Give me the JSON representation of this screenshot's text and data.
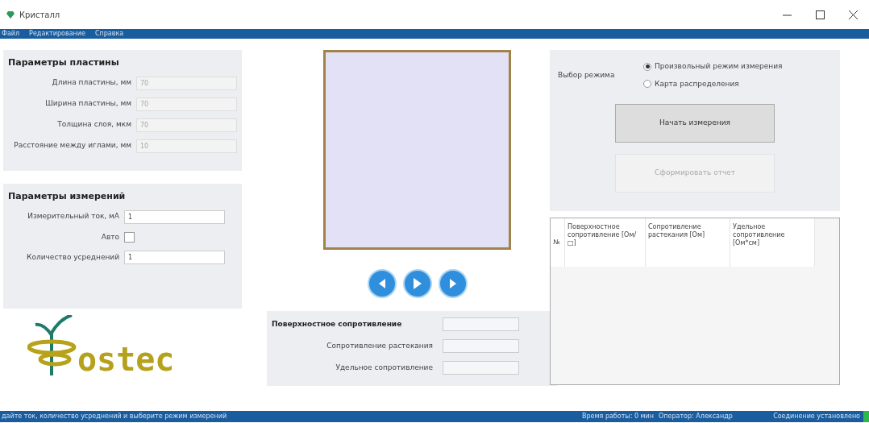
{
  "window": {
    "title": "Кристалл"
  },
  "menu": [
    "Файл",
    "Редактирование",
    "Справка"
  ],
  "plate_params": {
    "title": "Параметры пластины",
    "fields": [
      {
        "label": "Длина пластины, мм",
        "value": "70",
        "disabled": true
      },
      {
        "label": "Ширина пластины, мм",
        "value": "70",
        "disabled": true
      },
      {
        "label": "Толщина слоя, мкм",
        "value": "70",
        "disabled": true
      },
      {
        "label": "Расстояние между иглами, мм",
        "value": "10",
        "disabled": true
      }
    ]
  },
  "measure_params": {
    "title": "Параметры измерений",
    "rows": [
      {
        "kind": "input",
        "label": "Измерительный ток, мА",
        "value": "1"
      },
      {
        "kind": "checkbox",
        "label": "Авто",
        "checked": false
      },
      {
        "kind": "input",
        "label": "Количество усреднений",
        "value": "1"
      }
    ]
  },
  "logo": {
    "text": "ostec"
  },
  "nav_buttons": [
    {
      "kind": "back"
    },
    {
      "kind": "play"
    },
    {
      "kind": "forward"
    }
  ],
  "results": [
    {
      "label": "Поверхностное сопротивление",
      "bold": true
    },
    {
      "label": "Сопротивление растекания",
      "bold": false
    },
    {
      "label": "Удельное сопротивление",
      "bold": false
    }
  ],
  "mode": {
    "label": "Выбор режима",
    "options": [
      {
        "label": "Произвольный режим измерения",
        "selected": true
      },
      {
        "label": "Карта распределения",
        "selected": false
      }
    ]
  },
  "buttons": [
    {
      "label": "Начать измерения",
      "disabled": false
    },
    {
      "label": "Сформировать отчет",
      "disabled": true
    }
  ],
  "table": {
    "columns": [
      "№",
      "Поверхностное сопротивление [Ом/□]",
      "Сопротивление растекания [Ом]",
      "Удельное сопротивление [Ом*см]"
    ]
  },
  "status_bar": {
    "message": "дайте ток, количество усреднений и выберите режим измерений",
    "work_time": "Время работы: 0 мин",
    "operator": "Оператор: Александр",
    "connection": "Соединение установлено",
    "connected": true
  }
}
